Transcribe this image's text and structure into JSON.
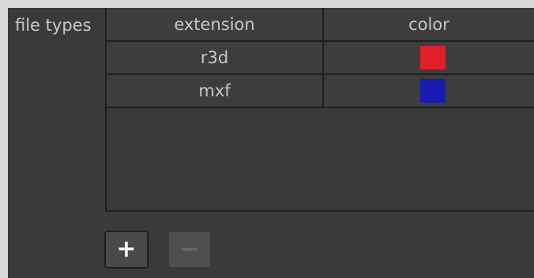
{
  "section": {
    "label": "file types"
  },
  "table": {
    "headers": {
      "extension": "extension",
      "color": "color"
    },
    "rows": [
      {
        "extension": "r3d",
        "color": "#e0202a"
      },
      {
        "extension": "mxf",
        "color": "#1a1ab4"
      }
    ]
  },
  "buttons": {
    "add_label": "+",
    "remove_label": "−",
    "remove_enabled": false
  }
}
